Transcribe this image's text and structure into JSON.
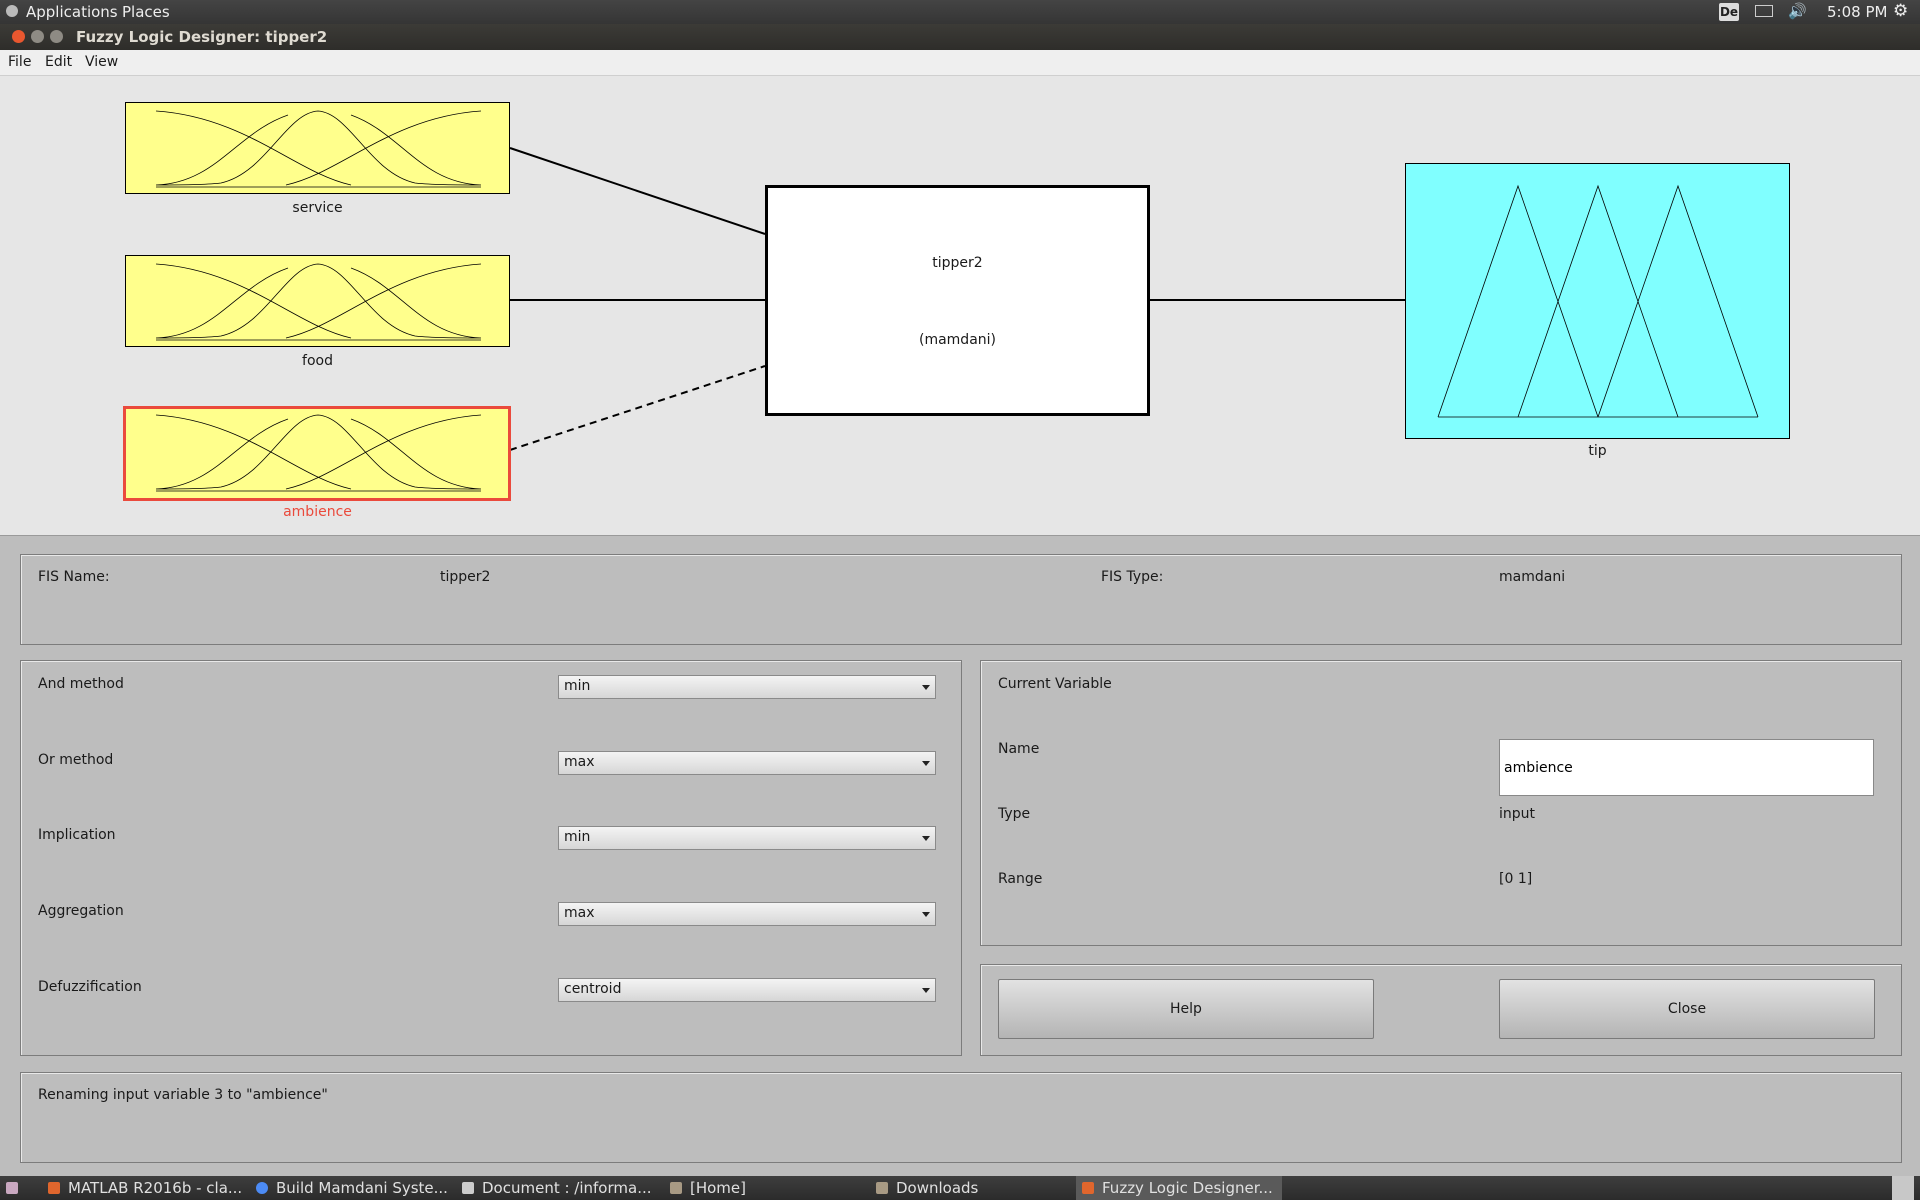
{
  "top_panel": {
    "applications": "Applications",
    "places": "Places",
    "keyboard_indicator": "De",
    "clock": "5:08 PM"
  },
  "window": {
    "title": "Fuzzy Logic Designer: tipper2"
  },
  "menu": [
    "File",
    "Edit",
    "View"
  ],
  "diagram": {
    "inputs": [
      "service",
      "food",
      "ambience"
    ],
    "selected_input": "ambience",
    "system_name": "tipper2",
    "system_type": "(mamdani)",
    "output": "tip",
    "colors": {
      "input_fill": "#ffff8c",
      "output_fill": "#80ffff",
      "selection": "#ea4a3c"
    }
  },
  "fis": {
    "name_label": "FIS Name:",
    "name_value": "tipper2",
    "type_label": "FIS Type:",
    "type_value": "mamdani"
  },
  "methods": [
    {
      "label": "And method",
      "value": "min"
    },
    {
      "label": "Or method",
      "value": "max"
    },
    {
      "label": "Implication",
      "value": "min"
    },
    {
      "label": "Aggregation",
      "value": "max"
    },
    {
      "label": "Defuzzification",
      "value": "centroid"
    }
  ],
  "current_variable": {
    "title": "Current Variable",
    "name_label": "Name",
    "name_value": "ambience",
    "type_label": "Type",
    "type_value": "input",
    "range_label": "Range",
    "range_value": "[0 1]"
  },
  "buttons": {
    "help": "Help",
    "close": "Close"
  },
  "status": "Renaming input variable 3 to \"ambience\"",
  "taskbar": [
    {
      "label": "MATLAB R2016b - cla...",
      "icon": "matlab-icon"
    },
    {
      "label": "Build Mamdani Syste...",
      "icon": "chrome-icon"
    },
    {
      "label": "Document : /informa...",
      "icon": "document-icon"
    },
    {
      "label": "[Home]",
      "icon": "folder-icon"
    },
    {
      "label": "Downloads",
      "icon": "folder-icon"
    },
    {
      "label": "Fuzzy Logic Designer...",
      "icon": "matlab-icon",
      "active": true
    }
  ]
}
